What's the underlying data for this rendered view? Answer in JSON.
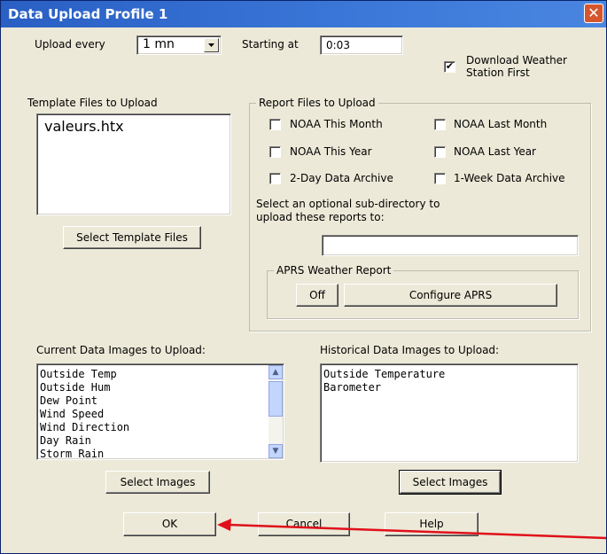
{
  "window": {
    "title": "Data Upload Profile 1",
    "close_glyph": "✕"
  },
  "upload": {
    "every_label": "Upload every",
    "interval_value": "1 mn",
    "starting_at_label": "Starting at",
    "starting_at_value": "0:03",
    "download_first_line1": "Download Weather",
    "download_first_line2": "Station First",
    "download_first_checked": "✔"
  },
  "template": {
    "label": "Template Files to Upload",
    "files": [
      "valeurs.htx"
    ],
    "select_button": "Select Template Files"
  },
  "reports": {
    "group_title": "Report Files to Upload",
    "items": [
      "NOAA This Month",
      "NOAA Last Month",
      "NOAA This Year",
      "NOAA Last Year",
      "2-Day Data Archive",
      "1-Week Data Archive"
    ],
    "subdir_line1": "Select an optional sub-directory to",
    "subdir_line2": "upload these reports to:",
    "subdir_value": ""
  },
  "aprs": {
    "group_title": "APRS Weather Report",
    "off_button": "Off",
    "configure_button": "Configure APRS"
  },
  "current_images": {
    "label": "Current Data Images to Upload:",
    "items": [
      "Outside Temp",
      "Outside Hum",
      "Dew Point",
      "Wind Speed",
      "Wind Direction",
      "Day Rain",
      "Storm Rain"
    ],
    "select_button": "Select Images"
  },
  "historical_images": {
    "label": "Historical Data Images to Upload:",
    "items": [
      "Outside Temperature",
      "Barometer"
    ],
    "select_button": "Select Images"
  },
  "footer": {
    "ok": "OK",
    "cancel": "Cancel",
    "help": "Help"
  },
  "colors": {
    "titlebar": "#2a5fc4",
    "dialog_bg": "#ece9d8",
    "arrow": "#e0101a"
  }
}
